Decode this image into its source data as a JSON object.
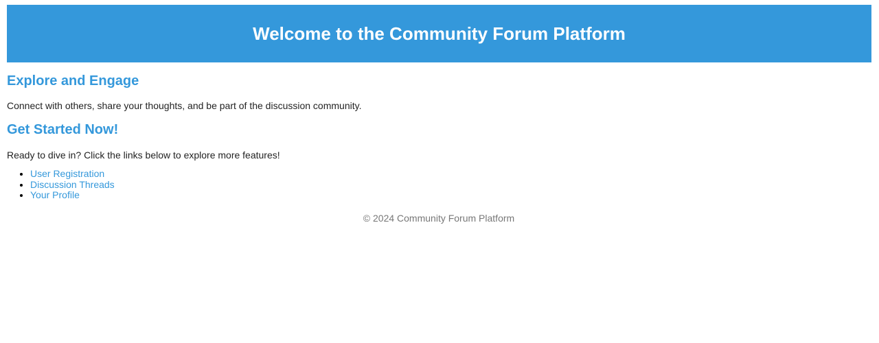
{
  "header": {
    "title": "Welcome to the Community Forum Platform"
  },
  "sections": [
    {
      "heading": "Explore and Engage",
      "text": "Connect with others, share your thoughts, and be part of the discussion community."
    },
    {
      "heading": "Get Started Now!",
      "text": "Ready to dive in? Click the links below to explore more features!"
    }
  ],
  "links": [
    {
      "label": "User Registration"
    },
    {
      "label": "Discussion Threads"
    },
    {
      "label": "Your Profile"
    }
  ],
  "footer": {
    "text": "© 2024 Community Forum Platform"
  },
  "colors": {
    "accent": "#3498db",
    "header_text": "#ffffff",
    "body_text": "#222222",
    "footer_text": "#777777"
  }
}
